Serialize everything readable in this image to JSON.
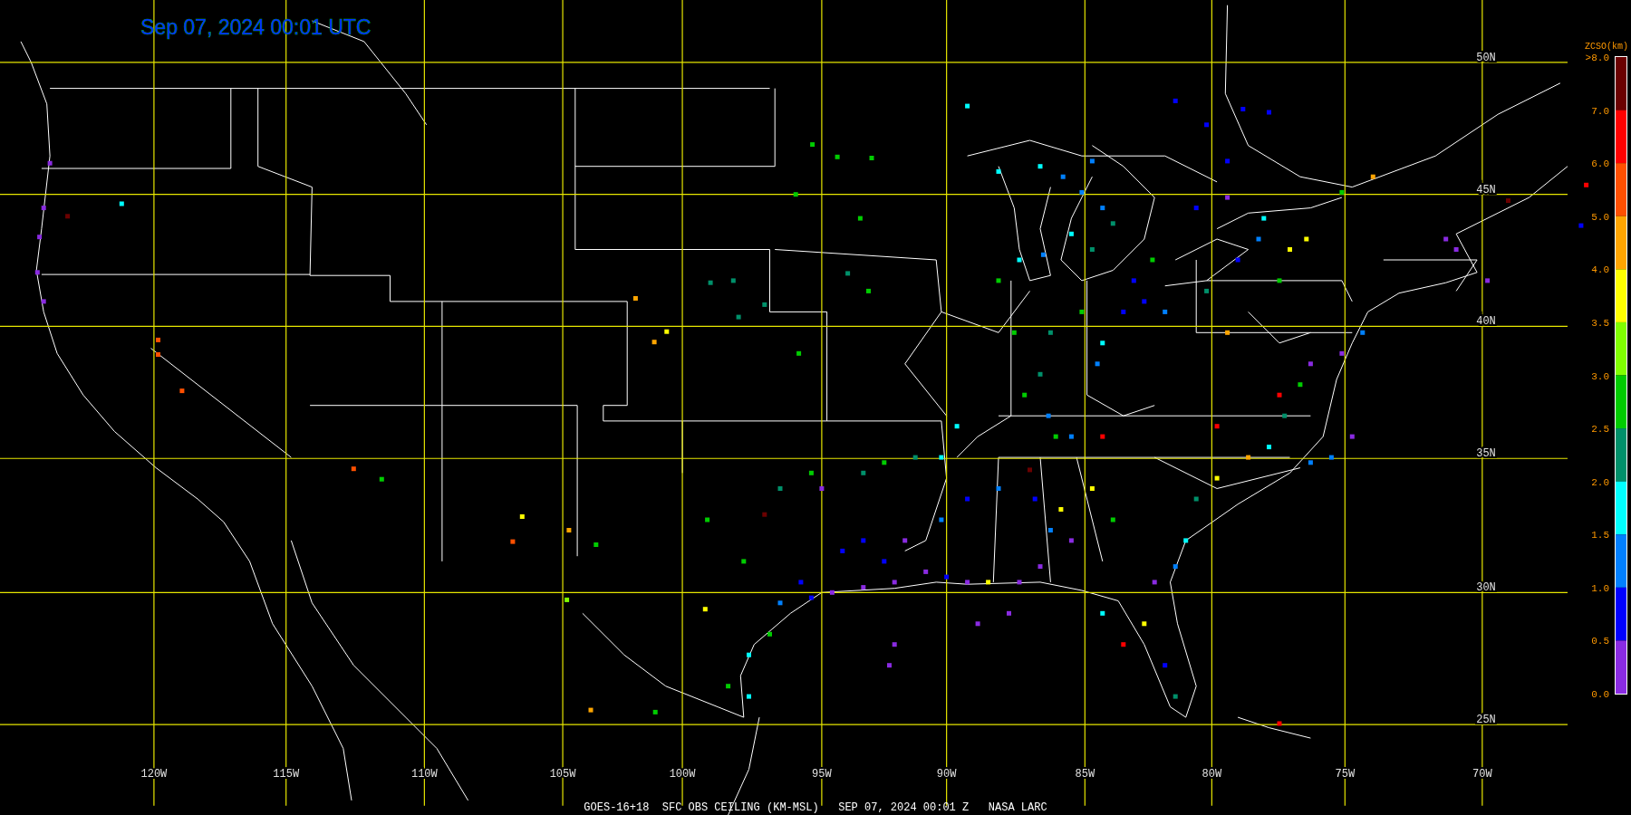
{
  "title": "Sep 07, 2024 00:01 UTC",
  "map": {
    "latitude_labels": [
      "50N",
      "45N",
      "40N",
      "35N",
      "30N",
      "25N"
    ],
    "longitude_labels": [
      "120W",
      "115W",
      "110W",
      "105W",
      "100W",
      "95W",
      "90W",
      "85W",
      "80W",
      "75W",
      "70W"
    ]
  },
  "legend": {
    "title": "ZCSO(km)",
    "labels": [
      ">8.0",
      "7.0",
      "6.0",
      "5.0",
      "4.0",
      "3.5",
      "3.0",
      "2.5",
      "2.0",
      "1.5",
      "1.0",
      "0.5",
      "0.0"
    ],
    "segments": [
      {
        "color": "#6b0000"
      },
      {
        "color": "#ff0000"
      },
      {
        "color": "#ff5000"
      },
      {
        "color": "#ffa500"
      },
      {
        "color": "#ffff00"
      },
      {
        "color": "#80ff00"
      },
      {
        "color": "#00cc00"
      },
      {
        "color": "#00906a"
      },
      {
        "color": "#00ffff"
      },
      {
        "color": "#0080ff"
      },
      {
        "color": "#0000ff"
      },
      {
        "color": "#8a2be2"
      }
    ]
  },
  "caption": "GOES-16+18  SFC OBS CEILING (KM-MSL)   SEP 07, 2024 00:01 Z   NASA LARC"
}
